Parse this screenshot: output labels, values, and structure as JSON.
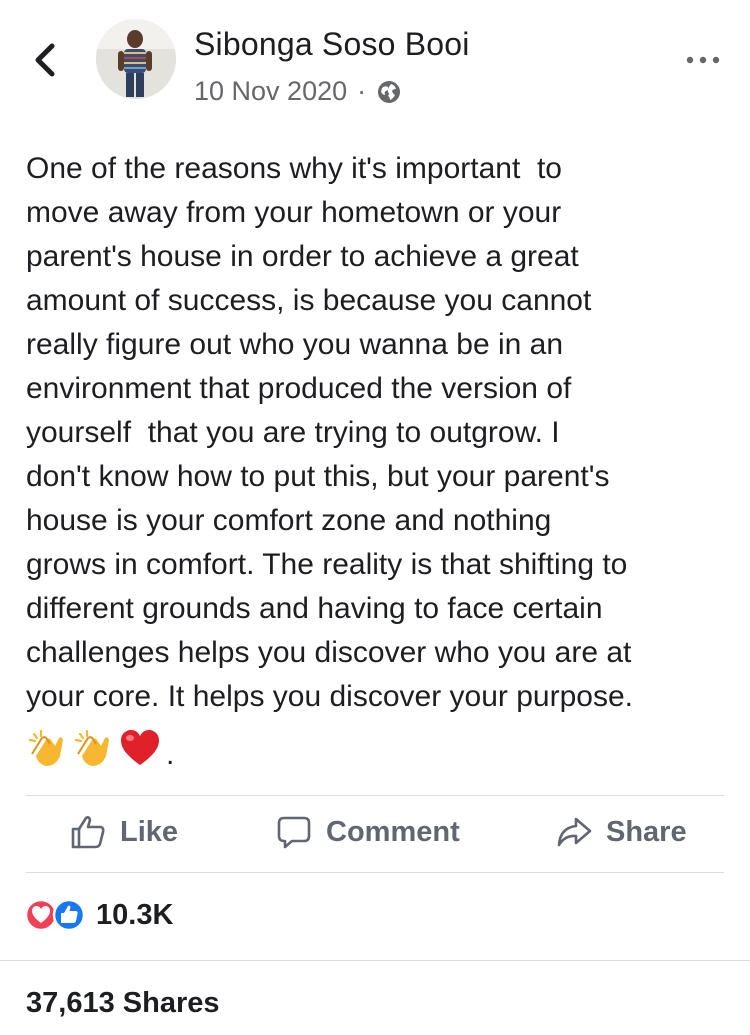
{
  "post": {
    "author": "Sibonga Soso Booi",
    "date": "10 Nov 2020",
    "meta_separator": "·",
    "audience_icon": "globe-icon",
    "text_lines": [
      "One of the reasons why it's important  to",
      "move away from your hometown or your",
      "parent's house in order to achieve a great",
      "amount of success, is because you cannot",
      "really figure out who you wanna be in an",
      "environment that produced the version of",
      "yourself  that you are trying to outgrow. I",
      "don't know how to put this, but your parent's",
      "house is your comfort zone and nothing",
      "grows in comfort. The reality is that shifting to",
      "different grounds and having to face certain",
      "challenges helps you discover who you are at",
      "your core. It helps you discover your purpose."
    ],
    "emojis": [
      "clapping-hands-emoji",
      "clapping-hands-emoji",
      "red-heart-emoji"
    ],
    "emoji_trailing": "."
  },
  "actions": {
    "like_label": "Like",
    "comment_label": "Comment",
    "share_label": "Share"
  },
  "engagement": {
    "reaction_icons": [
      "love-reaction-icon",
      "like-reaction-icon"
    ],
    "reaction_count": "10.3K",
    "shares_text": "37,613 Shares"
  },
  "colors": {
    "text": "#1c1e21",
    "secondary": "#65676b",
    "action": "#606770",
    "divider": "#dadde1",
    "love": "#f33e58",
    "like": "#1877f2"
  }
}
